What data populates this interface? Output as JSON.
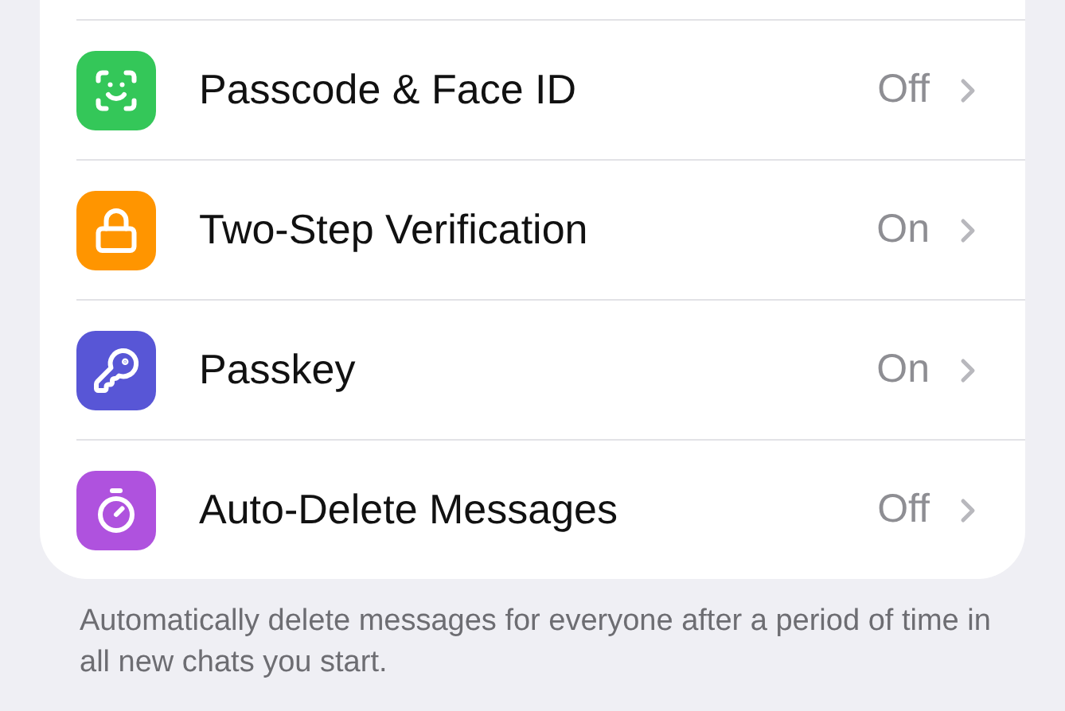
{
  "settings": [
    {
      "kind": "face-id",
      "color": "#34c759",
      "label": "Passcode & Face ID",
      "value": "Off"
    },
    {
      "kind": "lock",
      "color": "#ff9500",
      "label": "Two-Step Verification",
      "value": "On"
    },
    {
      "kind": "key",
      "color": "#5856d6",
      "label": "Passkey",
      "value": "On"
    },
    {
      "kind": "timer",
      "color": "#af52de",
      "label": "Auto-Delete Messages",
      "value": "Off"
    }
  ],
  "footer": "Automatically delete messages for everyone after a period of time in all new chats you start."
}
